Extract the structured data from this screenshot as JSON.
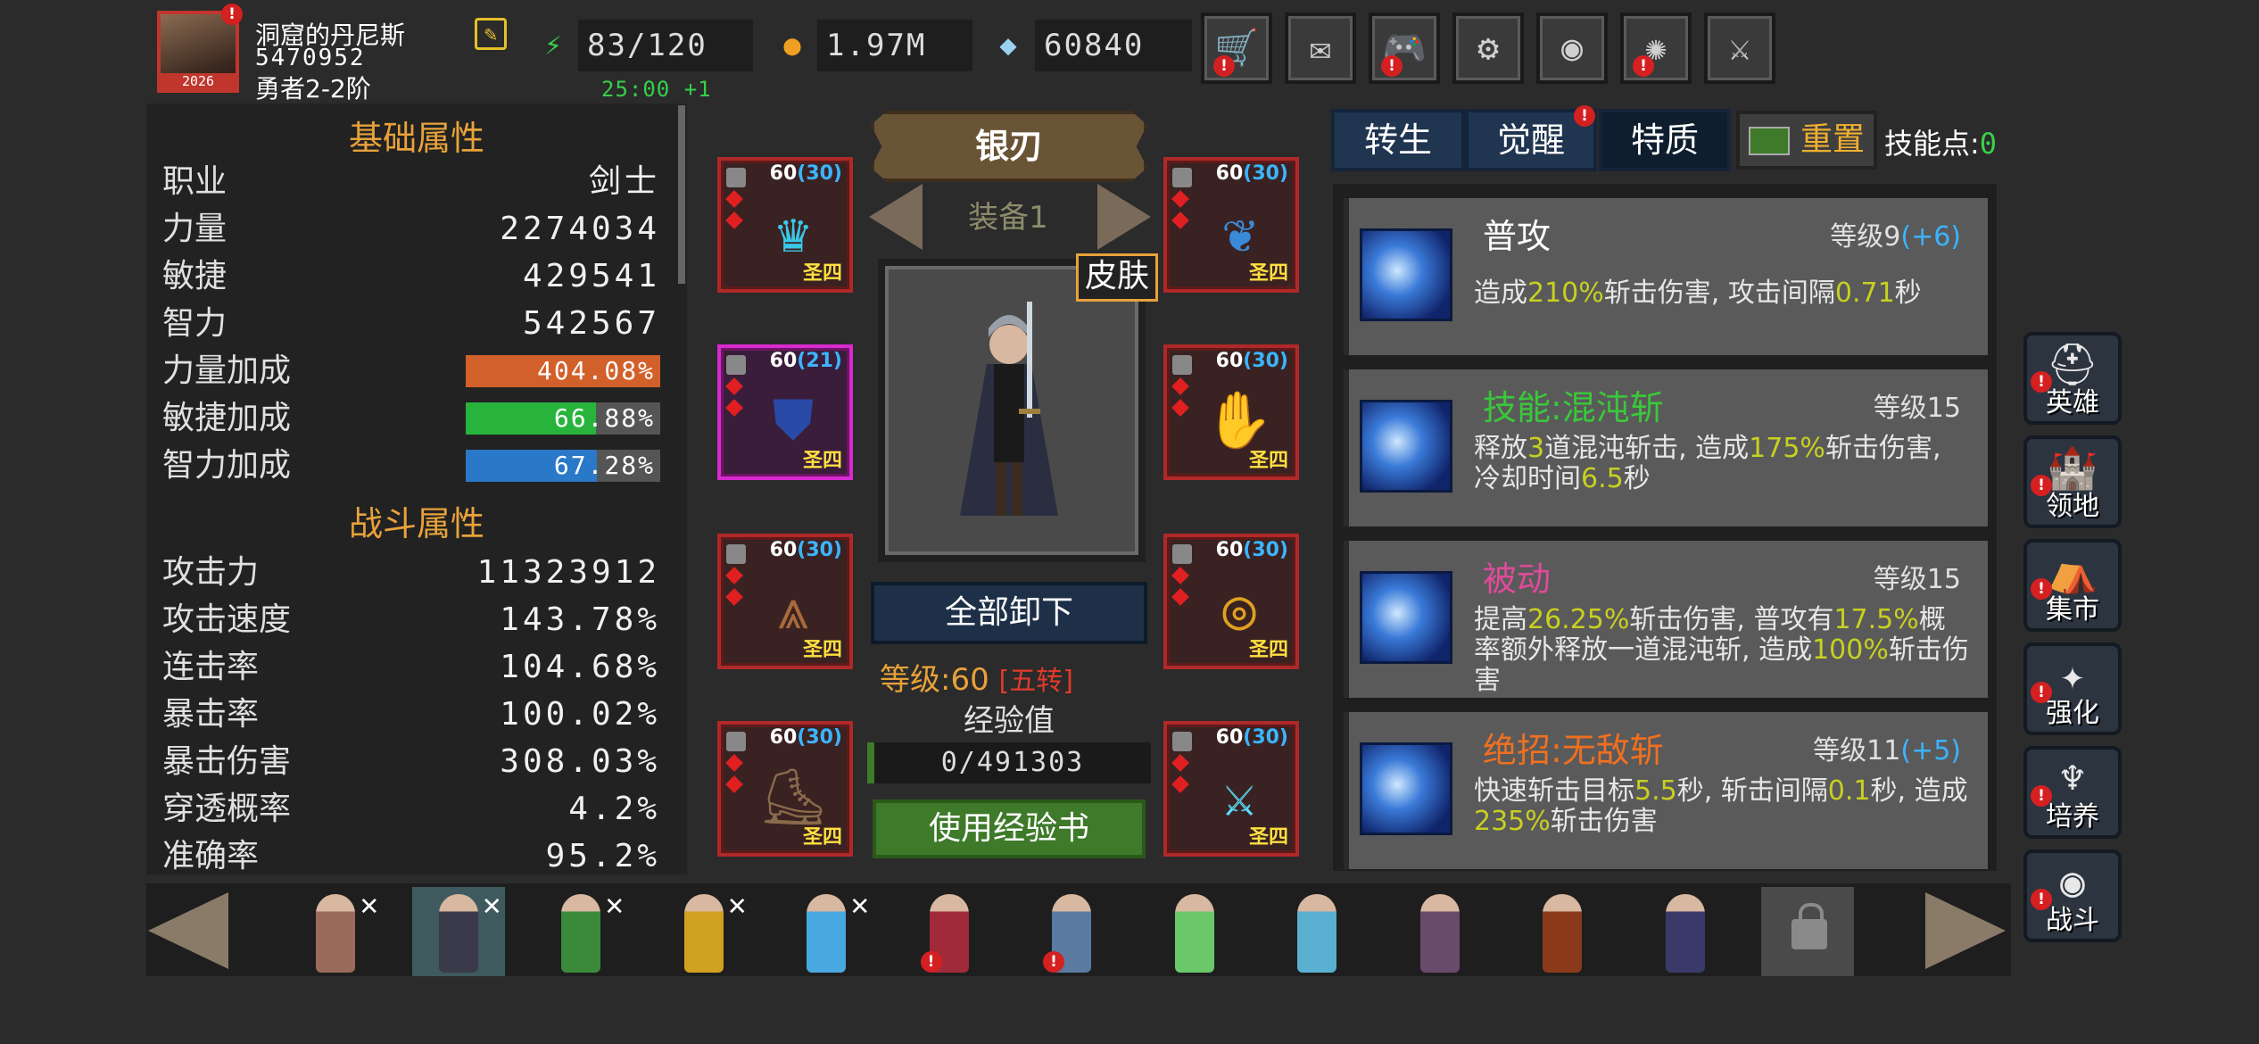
{
  "player": {
    "name": "洞窟的丹尼斯",
    "id": "5470952",
    "rank": "勇者2-2阶",
    "avatar_badge": "2026",
    "alert": "!"
  },
  "resources": {
    "energy": "83/120",
    "energy_timer": "25:00 +1",
    "gold": "1.97M",
    "gems": "60840"
  },
  "top_buttons": [
    {
      "name": "shop",
      "icon": "cart-icon",
      "glyph": "🛒",
      "alert": true
    },
    {
      "name": "mail",
      "icon": "mail-icon",
      "glyph": "✉",
      "alert": false
    },
    {
      "name": "gamepad",
      "icon": "gamepad-icon",
      "glyph": "🎮",
      "alert": true
    },
    {
      "name": "settings",
      "icon": "gear-icon",
      "glyph": "⚙",
      "alert": false
    },
    {
      "name": "gacha",
      "icon": "color-wheel-icon",
      "glyph": "◉",
      "alert": false
    },
    {
      "name": "fireworks",
      "icon": "fireworks-icon",
      "glyph": "✺",
      "alert": true
    },
    {
      "name": "battle",
      "icon": "crossed-swords-icon",
      "glyph": "⚔",
      "alert": false
    }
  ],
  "base_attrs": {
    "title": "基础属性",
    "rows": [
      {
        "k": "职业",
        "v": "剑士"
      },
      {
        "k": "力量",
        "v": "2274034"
      },
      {
        "k": "敏捷",
        "v": "429541"
      },
      {
        "k": "智力",
        "v": "542567"
      }
    ],
    "bars": [
      {
        "k": "力量加成",
        "v": "404.08%",
        "fill": 1.0,
        "color": "#d2602a"
      },
      {
        "k": "敏捷加成",
        "v": "66.88%",
        "fill": 0.6688,
        "color": "#28b43c"
      },
      {
        "k": "智力加成",
        "v": "67.28%",
        "fill": 0.6728,
        "color": "#2a78c8"
      }
    ]
  },
  "combat_attrs": {
    "title": "战斗属性",
    "rows": [
      {
        "k": "攻击力",
        "v": "11323912"
      },
      {
        "k": "攻击速度",
        "v": "143.78%"
      },
      {
        "k": "连击率",
        "v": "104.68%"
      },
      {
        "k": "暴击率",
        "v": "100.02%"
      },
      {
        "k": "暴击伤害",
        "v": "308.03%"
      },
      {
        "k": "穿透概率",
        "v": "4.2%"
      },
      {
        "k": "准确率",
        "v": "95.2%"
      }
    ]
  },
  "equipment": {
    "weapon_name": "银刃",
    "set_label": "装备1",
    "skin_label": "皮肤",
    "unequip_all": "全部卸下",
    "level_label": "等级:60",
    "rebirth": "[五转]",
    "xp_label": "经验值",
    "xp_value": "0/491303",
    "use_xp_book": "使用经验书",
    "slots": [
      {
        "level": "60",
        "bonus": "(30)",
        "tier": "圣四",
        "icon": "crown-icon",
        "glyph": "♛",
        "color": "#3ac8e8",
        "pink": false
      },
      {
        "level": "60",
        "bonus": "(30)",
        "tier": "圣四",
        "icon": "amulet-icon",
        "glyph": "❦",
        "color": "#3a8ad8",
        "pink": false
      },
      {
        "level": "60",
        "bonus": "(21)",
        "tier": "圣四",
        "icon": "armor-icon",
        "glyph": "⛊",
        "color": "#2a4aa8",
        "pink": true
      },
      {
        "level": "60",
        "bonus": "(30)",
        "tier": "圣四",
        "icon": "gauntlet-icon",
        "glyph": "✋",
        "color": "#c8a020",
        "pink": false
      },
      {
        "level": "60",
        "bonus": "(30)",
        "tier": "圣四",
        "icon": "leggings-icon",
        "glyph": "⩓",
        "color": "#a86a3a",
        "pink": false
      },
      {
        "level": "60",
        "bonus": "(30)",
        "tier": "圣四",
        "icon": "ring-icon",
        "glyph": "◎",
        "color": "#e0a020",
        "pink": false
      },
      {
        "level": "60",
        "bonus": "(30)",
        "tier": "圣四",
        "icon": "boots-icon",
        "glyph": "⛸",
        "color": "#8a6a4a",
        "pink": false
      },
      {
        "level": "60",
        "bonus": "(30)",
        "tier": "圣四",
        "icon": "sword-icon",
        "glyph": "⚔",
        "color": "#5ae0ff",
        "pink": false
      }
    ]
  },
  "tabs": {
    "rebirth": "转生",
    "awaken": "觉醒",
    "trait": "特质",
    "reset": "重置",
    "skill_points_label": "技能点:",
    "skill_points": "0"
  },
  "skills": [
    {
      "name": "普攻",
      "name_color": "#ffffff",
      "grade": "等级9",
      "bonus": "(+6)",
      "desc": [
        [
          "造成",
          ""
        ],
        [
          "210%",
          "hl"
        ],
        [
          "斩击伤害, 攻击间隔",
          ""
        ],
        [
          "0.71",
          "hl"
        ],
        [
          "秒",
          ""
        ]
      ]
    },
    {
      "name": "技能:混沌斩",
      "name_color": "#3ac83a",
      "grade": "等级15",
      "bonus": "",
      "desc": [
        [
          "释放",
          ""
        ],
        [
          "3",
          "hl"
        ],
        [
          "道混沌斩击, 造成",
          ""
        ],
        [
          "175%",
          "hl"
        ],
        [
          "斩击伤害, 冷却时间",
          ""
        ],
        [
          "6.5",
          "hl"
        ],
        [
          "秒",
          ""
        ]
      ]
    },
    {
      "name": "被动",
      "name_color": "#e04a9a",
      "grade": "等级15",
      "bonus": "",
      "desc": [
        [
          "提高",
          ""
        ],
        [
          "26.25%",
          "hl"
        ],
        [
          "斩击伤害, 普攻有",
          ""
        ],
        [
          "17.5%",
          "hl"
        ],
        [
          "概率额外释放一道混沌斩, 造成",
          ""
        ],
        [
          "100%",
          "hl"
        ],
        [
          "斩击伤害",
          ""
        ]
      ]
    },
    {
      "name": "绝招:无敌斩",
      "name_color": "#f07020",
      "grade": "等级11",
      "bonus": "(+5)",
      "desc": [
        [
          "快速斩击目标",
          ""
        ],
        [
          "5.5",
          "hl"
        ],
        [
          "秒, 斩击间隔",
          ""
        ],
        [
          "0.1",
          "hl"
        ],
        [
          "秒, 造成",
          ""
        ],
        [
          "235%",
          "hl"
        ],
        [
          "斩击伤害",
          ""
        ]
      ]
    }
  ],
  "side_nav": [
    {
      "label": "英雄",
      "icon": "helmet-icon",
      "glyph": "⛑",
      "alert": true
    },
    {
      "label": "领地",
      "icon": "castle-icon",
      "glyph": "🏰",
      "alert": true
    },
    {
      "label": "集市",
      "icon": "market-icon",
      "glyph": "⛺",
      "alert": true
    },
    {
      "label": "强化",
      "icon": "emblem-icon",
      "glyph": "✦",
      "alert": true
    },
    {
      "label": "培养",
      "icon": "chalice-icon",
      "glyph": "♆",
      "alert": true
    },
    {
      "label": "战斗",
      "icon": "portal-icon",
      "glyph": "◉",
      "alert": true
    }
  ],
  "heroes": [
    {
      "color": "#9a6a5a",
      "x": true,
      "sel": false,
      "alert": false
    },
    {
      "color": "#3a3a4a",
      "x": true,
      "sel": true,
      "alert": false
    },
    {
      "color": "#3a8a3a",
      "x": true,
      "sel": false,
      "alert": false
    },
    {
      "color": "#d0a020",
      "x": true,
      "sel": false,
      "alert": false
    },
    {
      "color": "#4aa8e0",
      "x": true,
      "sel": false,
      "alert": false
    },
    {
      "color": "#a02a3a",
      "x": false,
      "sel": false,
      "alert": true
    },
    {
      "color": "#5a7aa0",
      "x": false,
      "sel": false,
      "alert": true
    },
    {
      "color": "#6ac86a",
      "x": false,
      "sel": false,
      "alert": false
    },
    {
      "color": "#5ab0d0",
      "x": false,
      "sel": false,
      "alert": false
    },
    {
      "color": "#6a4a6a",
      "x": false,
      "sel": false,
      "alert": false
    },
    {
      "color": "#8a3a1a",
      "x": false,
      "sel": false,
      "alert": false
    },
    {
      "color": "#3a3a6a",
      "x": false,
      "sel": false,
      "alert": false
    },
    {
      "locked": true
    }
  ],
  "colors": {
    "accent": "#e8a23a",
    "alert": "#d42020",
    "highlight": "#c8d020"
  }
}
